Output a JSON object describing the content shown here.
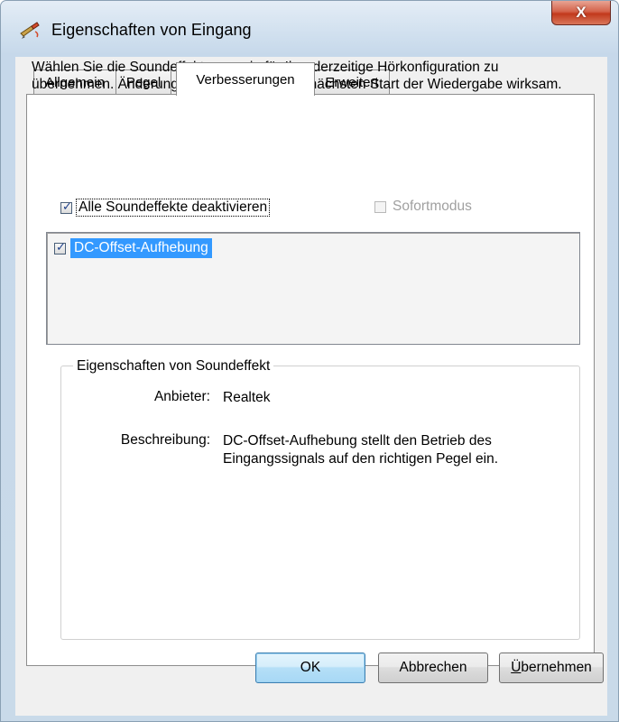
{
  "window": {
    "title": "Eigenschaften von Eingang",
    "close_glyph": "X"
  },
  "tabs": [
    {
      "label": "Allgemein",
      "active": false
    },
    {
      "label": "Pegel",
      "active": false
    },
    {
      "label": "Verbesserungen",
      "active": true
    },
    {
      "label": "Erweitert",
      "active": false
    }
  ],
  "enhancements": {
    "description": "Wählen Sie die Soundeffekte, um sie für Ihre derzeitige Hörkonfiguration zu übernehmen. Änderungen werden erst beim nächsten Start der Wiedergabe wirksam.",
    "disable_all_label": "Alle Soundeffekte deaktivieren",
    "disable_all_checked": true,
    "immediate_mode_label": "Sofortmodus",
    "immediate_mode_checked": false,
    "immediate_mode_enabled": false,
    "effects": [
      {
        "label": "DC-Offset-Aufhebung",
        "checked": true,
        "selected": true
      }
    ]
  },
  "effect_properties": {
    "group_title": "Eigenschaften von Soundeffekt",
    "provider_label": "Anbieter:",
    "provider_value": "Realtek",
    "description_label": "Beschreibung:",
    "description_value": "DC-Offset-Aufhebung stellt den Betrieb des Eingangssignals auf den richtigen Pegel ein."
  },
  "buttons": {
    "ok": "OK",
    "cancel": "Abbrechen",
    "apply_first": "Ü",
    "apply_rest": "bernehmen"
  }
}
